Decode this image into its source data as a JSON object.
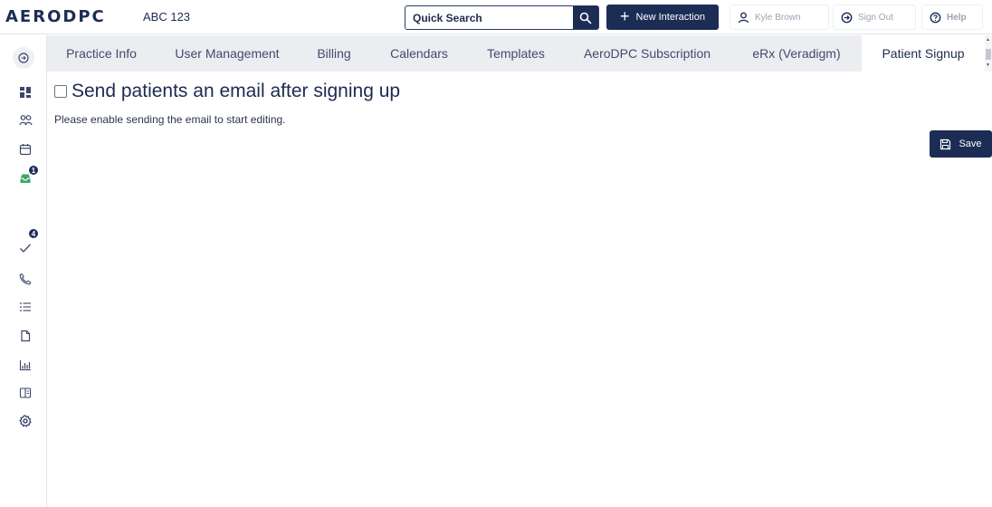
{
  "header": {
    "logo_text": "AERODPC",
    "practice_name": "ABC 123",
    "search_placeholder": "Quick Search",
    "new_interaction_label": "New Interaction",
    "user_label": "Kyle Brown",
    "sign_out_label": "Sign Out",
    "help_label": "Help"
  },
  "sidebar": {
    "items": [
      {
        "icon": "dashboard-icon"
      },
      {
        "icon": "patients-icon"
      },
      {
        "icon": "calendar-icon"
      },
      {
        "icon": "inbox-icon",
        "badge": "1"
      },
      {
        "icon": "tasks-check-icon",
        "badge": "4"
      },
      {
        "icon": "phone-icon"
      },
      {
        "icon": "list-icon"
      },
      {
        "icon": "document-icon"
      },
      {
        "icon": "reports-chart-icon"
      },
      {
        "icon": "book-icon"
      },
      {
        "icon": "settings-gear-icon",
        "active": true
      }
    ]
  },
  "tabs": [
    {
      "label": "Practice Info"
    },
    {
      "label": "User Management"
    },
    {
      "label": "Billing"
    },
    {
      "label": "Calendars"
    },
    {
      "label": "Templates"
    },
    {
      "label": "AeroDPC Subscription"
    },
    {
      "label": "eRx (Veradigm)"
    },
    {
      "label": "Patient Signup",
      "active": true
    }
  ],
  "content": {
    "checkbox_label": "Send patients an email after signing up",
    "checkbox_checked": false,
    "hint_text": "Please enable sending the email to start editing.",
    "save_label": "Save"
  },
  "colors": {
    "brand_navy": "#1c2d55",
    "tab_bar_bg": "#ecedf0",
    "muted_text": "#9aa2b1"
  }
}
